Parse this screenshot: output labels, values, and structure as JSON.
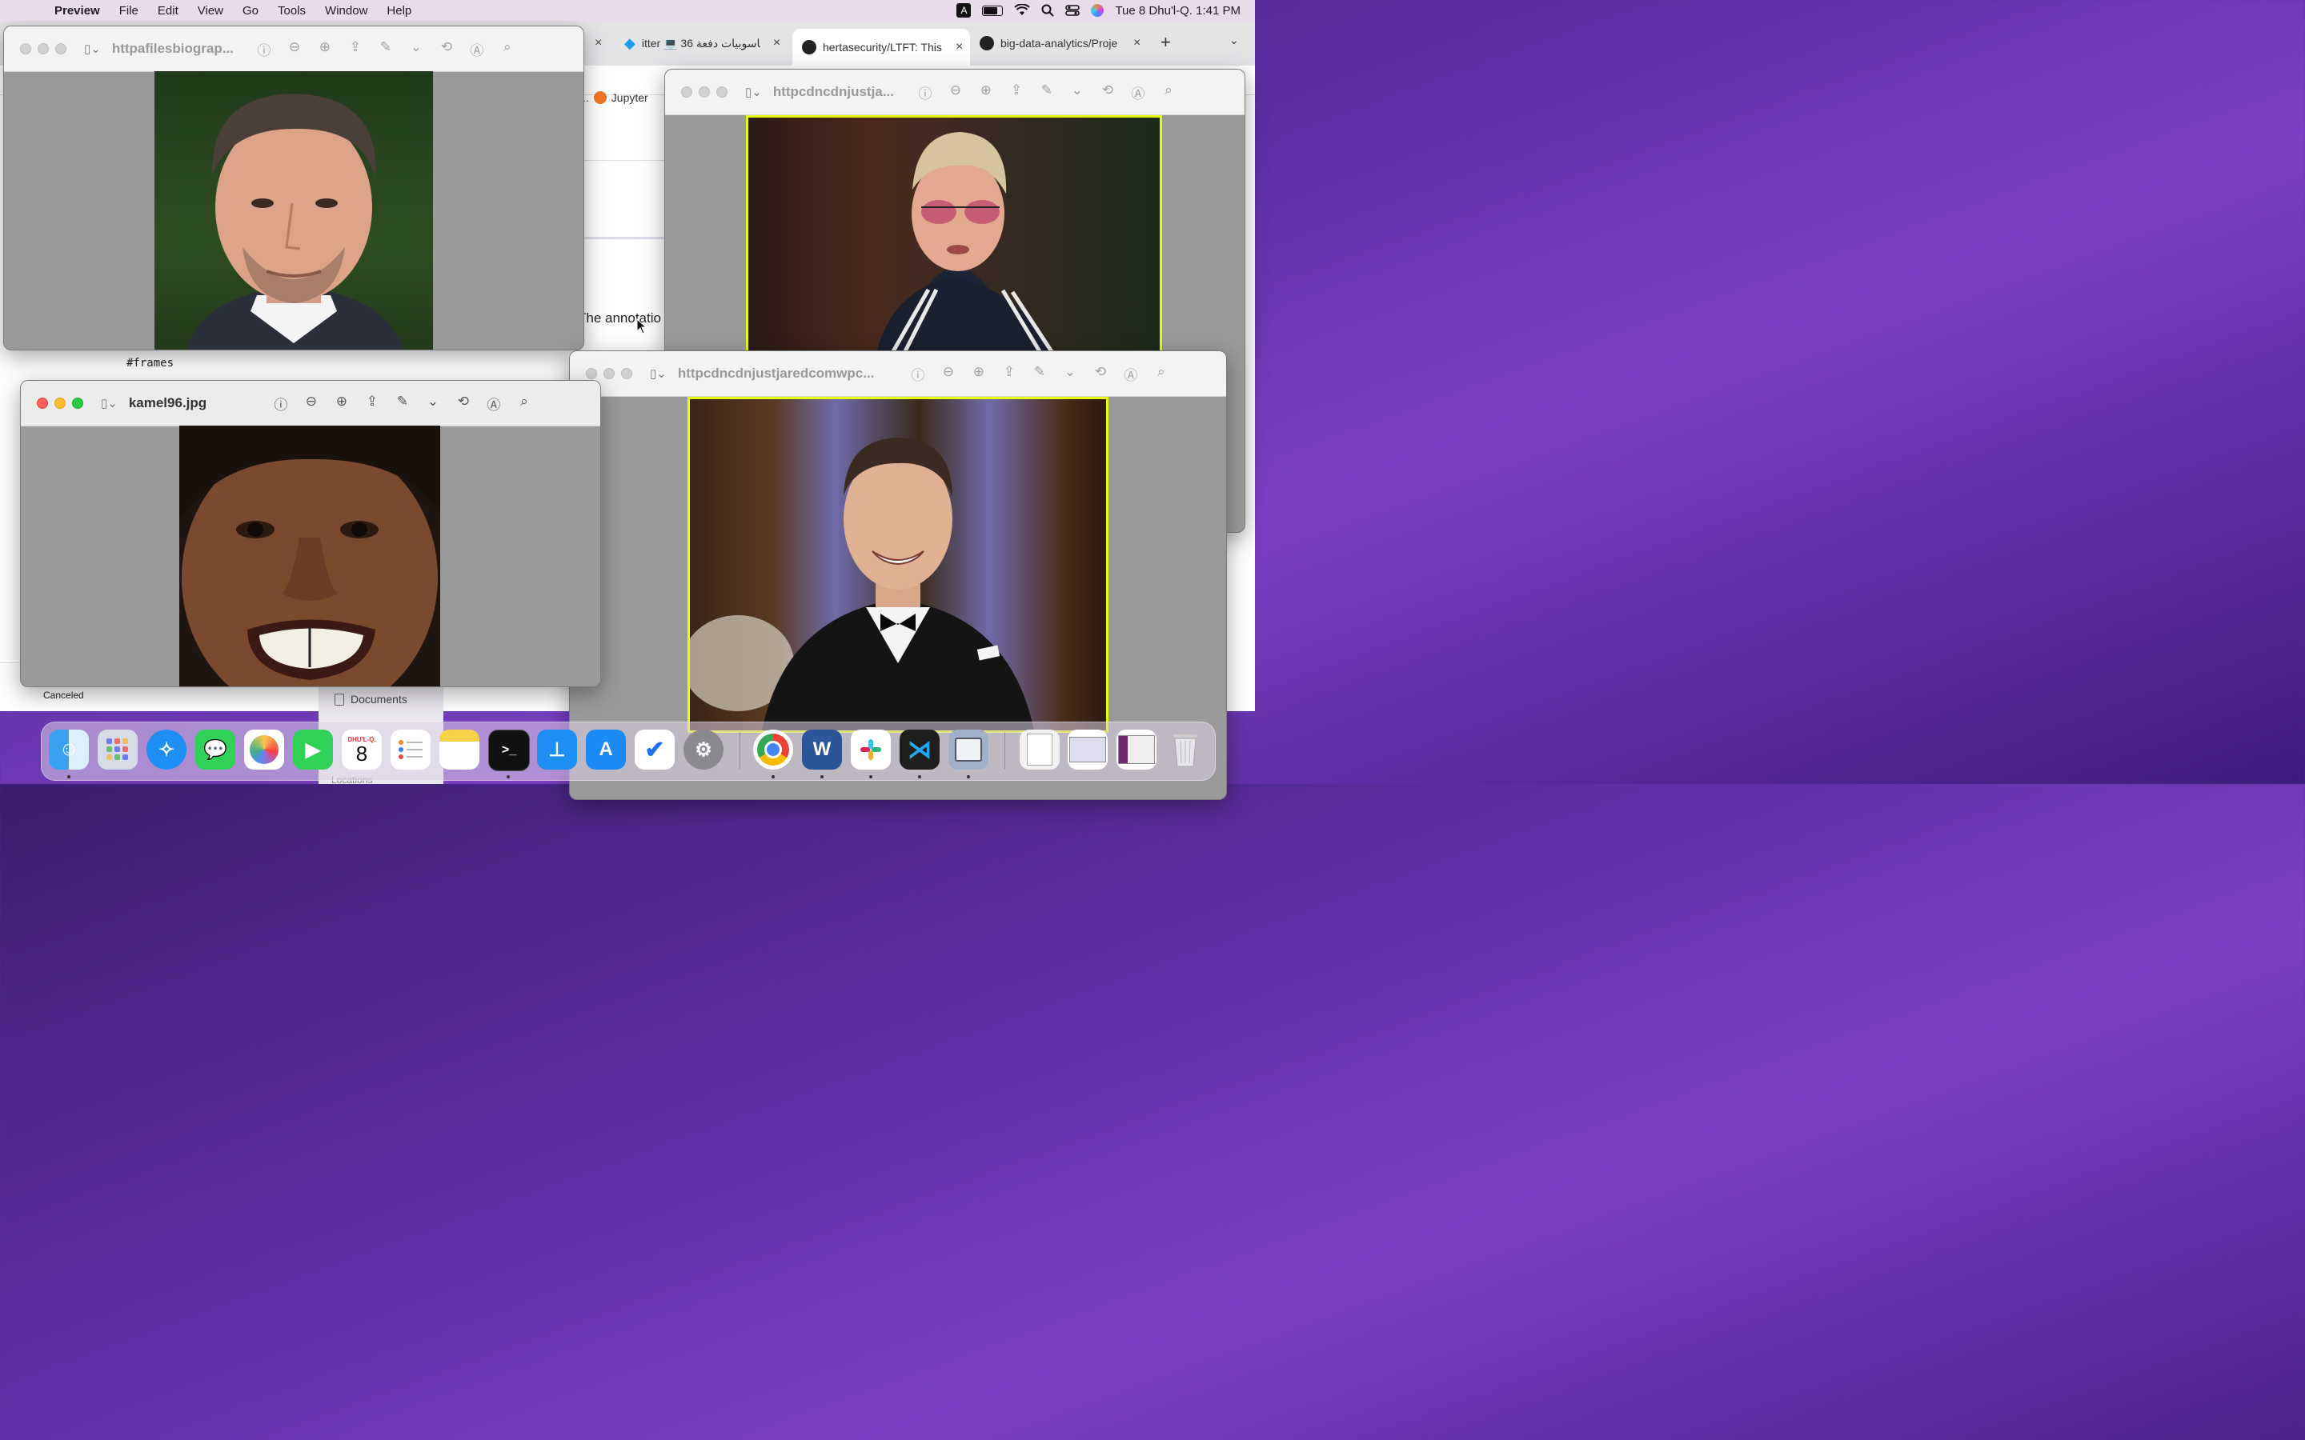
{
  "menubar": {
    "app": "Preview",
    "items": [
      "File",
      "Edit",
      "View",
      "Go",
      "Tools",
      "Window",
      "Help"
    ],
    "keyboard_indicator": "A",
    "clock": "Tue 8 Dhu'l-Q.  1:41 PM"
  },
  "browser": {
    "tabs": [
      {
        "label": "itter 💻 حاسوبيات دفعة 36",
        "icon": "bird-icon"
      },
      {
        "label": "hertasecurity/LTFT: This",
        "icon": "github-icon"
      },
      {
        "label": "big-data-analytics/Proje",
        "icon": "github-icon"
      }
    ],
    "tab_close": "×",
    "bookmark_prefix": "..",
    "bookmark_jupyter": "Jupyter",
    "code_line": "#frames",
    "annotation_text": "The annotatio",
    "status_text": "Canceled",
    "status_close": "×",
    "finder_documents": "Documents",
    "finder_locations": "Locations"
  },
  "windows": {
    "w1": {
      "title": "httpafilesbiograp..."
    },
    "w2": {
      "title": "httpcdncdnjustja..."
    },
    "w3": {
      "title": "kamel96.jpg"
    },
    "w4": {
      "title": "httpcdncdnjustjaredcomwpc..."
    }
  },
  "dock": {
    "calendar_month": "DHU'L-Q.",
    "calendar_day": "8",
    "word_letter": "W",
    "terminal_prompt": ">_"
  },
  "colors": {
    "yellow_border": "#e6ff00",
    "close": "#ff5f57",
    "minimize": "#febc2e",
    "zoom": "#28c840"
  }
}
